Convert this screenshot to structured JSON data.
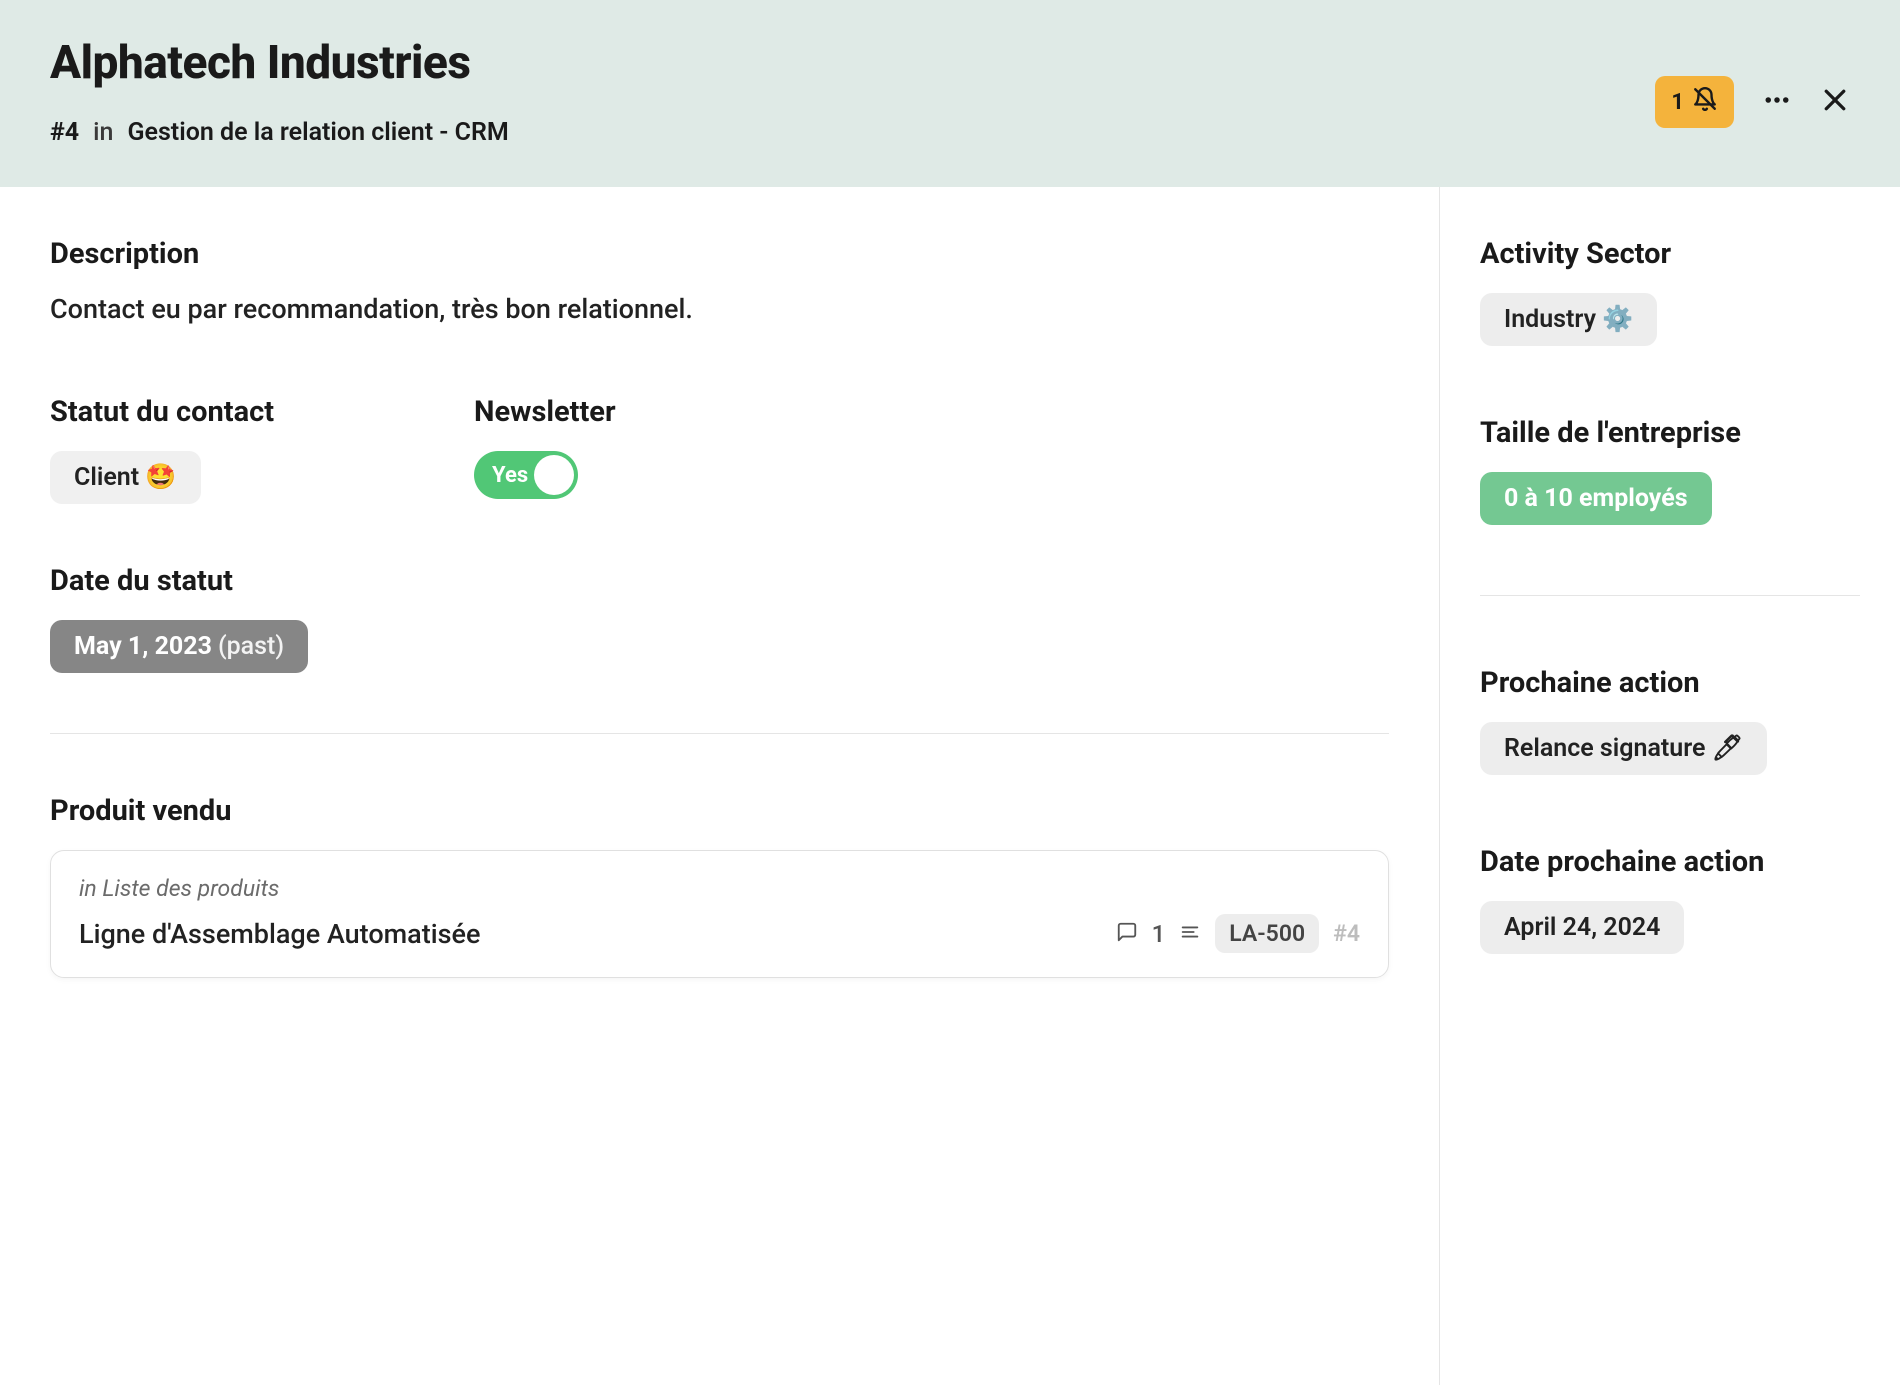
{
  "header": {
    "title": "Alphatech Industries",
    "record_id": "#4",
    "in_word": "in",
    "parent_name": "Gestion de la relation client - CRM",
    "subscribe_count": "1"
  },
  "fields": {
    "description": {
      "label": "Description",
      "value": "Contact eu par recommandation, très bon relationnel."
    },
    "contact_status": {
      "label": "Statut du contact",
      "value": "Client 🤩"
    },
    "newsletter": {
      "label": "Newsletter",
      "value": "Yes"
    },
    "status_date": {
      "label": "Date du statut",
      "value": "May 1, 2023",
      "suffix": "(past)"
    },
    "product_sold": {
      "label": "Produit vendu",
      "source_prefix": "in Liste des produits",
      "name": "Ligne d'Assemblage Automatisée",
      "comment_count": "1",
      "sku": "LA-500",
      "row": "#4"
    }
  },
  "sidebar": {
    "activity_sector": {
      "label": "Activity Sector",
      "value": "Industry ⚙️"
    },
    "company_size": {
      "label": "Taille de l'entreprise",
      "value": "0 à 10 employés"
    },
    "next_action": {
      "label": "Prochaine action",
      "value": "Relance signature 🖊"
    },
    "next_action_date": {
      "label": "Date prochaine action",
      "value": "April 24, 2024"
    }
  }
}
